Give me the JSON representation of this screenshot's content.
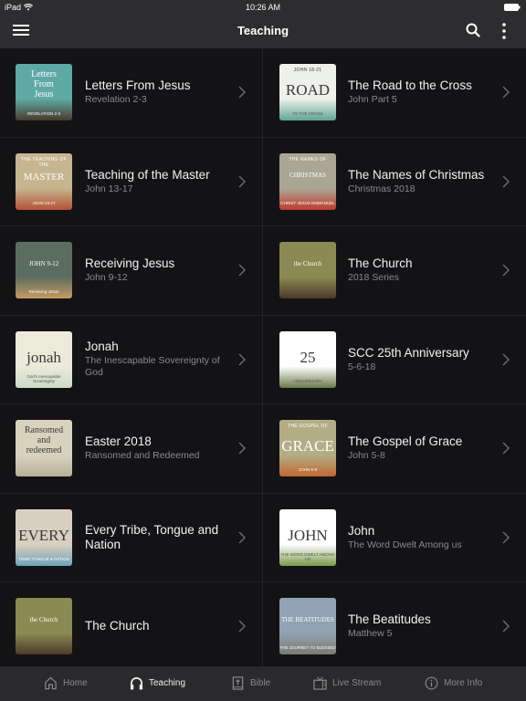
{
  "status_bar": {
    "carrier": "iPad",
    "time": "10:26 AM"
  },
  "nav_bar": {
    "title": "Teaching"
  },
  "series": [
    {
      "title": "Letters From Jesus",
      "subtitle": "Revelation 2-3",
      "art": {
        "lines": [
          "Letters",
          "From",
          "Jesus"
        ],
        "caption": "REVELATION 2-3",
        "bg": "#5fa9a5",
        "bg2": "#4a3b2c"
      }
    },
    {
      "title": "The Road to the Cross",
      "subtitle": "John Part 5",
      "art": {
        "lines": [
          "ROAD"
        ],
        "top": "JOHN 18-21",
        "caption": "TO THE CROSS",
        "bg": "#eef0ea",
        "bg2": "#5ea593"
      }
    },
    {
      "title": "Teaching of the Master",
      "subtitle": "John 13-17",
      "art": {
        "lines": [
          "MASTER"
        ],
        "top": "THE TEACHING OF THE",
        "caption": "JOHN 13-17",
        "bg": "#c6b58f",
        "bg2": "#b45236"
      }
    },
    {
      "title": "The Names of Christmas",
      "subtitle": "Christmas 2018",
      "art": {
        "lines": [
          "CHRISTMAS"
        ],
        "top": "THE NAMES OF",
        "caption": "CHRIST JESUS EMMANUEL",
        "bg": "#a9a793",
        "bg2": "#c23a2f"
      }
    },
    {
      "title": "Receiving Jesus",
      "subtitle": "John 9-12",
      "art": {
        "lines": [
          "JOHN 9-12"
        ],
        "caption": "Receiving Jesus",
        "bg": "#5b6d61",
        "bg2": "#c79a62"
      }
    },
    {
      "title": "The Church",
      "subtitle": "2018 Series",
      "art": {
        "lines": [
          "the Church"
        ],
        "bg": "#8a8a52",
        "bg2": "#4a3a2a"
      }
    },
    {
      "title": "Jonah",
      "subtitle": "The Inescapable Sovereignty of God",
      "art": {
        "lines": [
          "jonah"
        ],
        "caption": "God's Inescapable Sovereignty",
        "bg": "#eceadb",
        "bg2": "#cfd9c6"
      }
    },
    {
      "title": "SCC 25th Anniversary",
      "subtitle": "5-6-18",
      "art": {
        "lines": [
          "25"
        ],
        "caption": "ANNIVERSARY",
        "bg": "#ffffff",
        "bg2": "#6b7a4a"
      }
    },
    {
      "title": "Easter 2018",
      "subtitle": "Ransomed and Redeemed",
      "art": {
        "lines": [
          "Ransomed",
          "and",
          "redeemed"
        ],
        "bg": "#d9d2bd",
        "bg2": "#b8b19a"
      }
    },
    {
      "title": "The Gospel of Grace",
      "subtitle": "John 5-8",
      "art": {
        "lines": [
          "GRACE"
        ],
        "top": "THE GOSPEL OF",
        "caption": "JOHN 5-8",
        "bg": "#b3ad86",
        "bg2": "#c06830"
      }
    },
    {
      "title": "Every Tribe, Tongue and Nation",
      "subtitle": "",
      "art": {
        "lines": [
          "EVERY"
        ],
        "caption": "TRIBE TONGUE & NATION",
        "bg": "#d9cfc0",
        "bg2": "#6ea3b8"
      }
    },
    {
      "title": "John",
      "subtitle": "The Word Dwelt Among us",
      "art": {
        "lines": [
          "JOHN"
        ],
        "caption": "THE WORD DWELT AMONG US",
        "bg": "#ffffff",
        "bg2": "#7a9a4a"
      }
    },
    {
      "title": "The Church",
      "subtitle": "",
      "art": {
        "lines": [
          "the Church"
        ],
        "bg": "#8a8a52",
        "bg2": "#4a3a2a"
      }
    },
    {
      "title": "The Beatitudes",
      "subtitle": "Matthew 5",
      "art": {
        "lines": [
          "THE BEATITUDES"
        ],
        "caption": "THE JOURNEY TO BLESSED",
        "bg": "#8fa3b3",
        "bg2": "#7d7a6f"
      }
    }
  ],
  "tab_bar": {
    "tabs": [
      {
        "label": "Home",
        "icon": "home-icon",
        "active": false
      },
      {
        "label": "Teaching",
        "icon": "headphones-icon",
        "active": true
      },
      {
        "label": "Bible",
        "icon": "bible-icon",
        "active": false
      },
      {
        "label": "Live Stream",
        "icon": "tv-icon",
        "active": false
      },
      {
        "label": "More Info",
        "icon": "info-icon",
        "active": false
      }
    ]
  },
  "colors": {
    "background": "#131316",
    "bar": "#2d2d2f",
    "tab_active": "#f0f0f0",
    "tab_inactive": "#8a8a8c",
    "subtitle": "#8a8a8e"
  }
}
